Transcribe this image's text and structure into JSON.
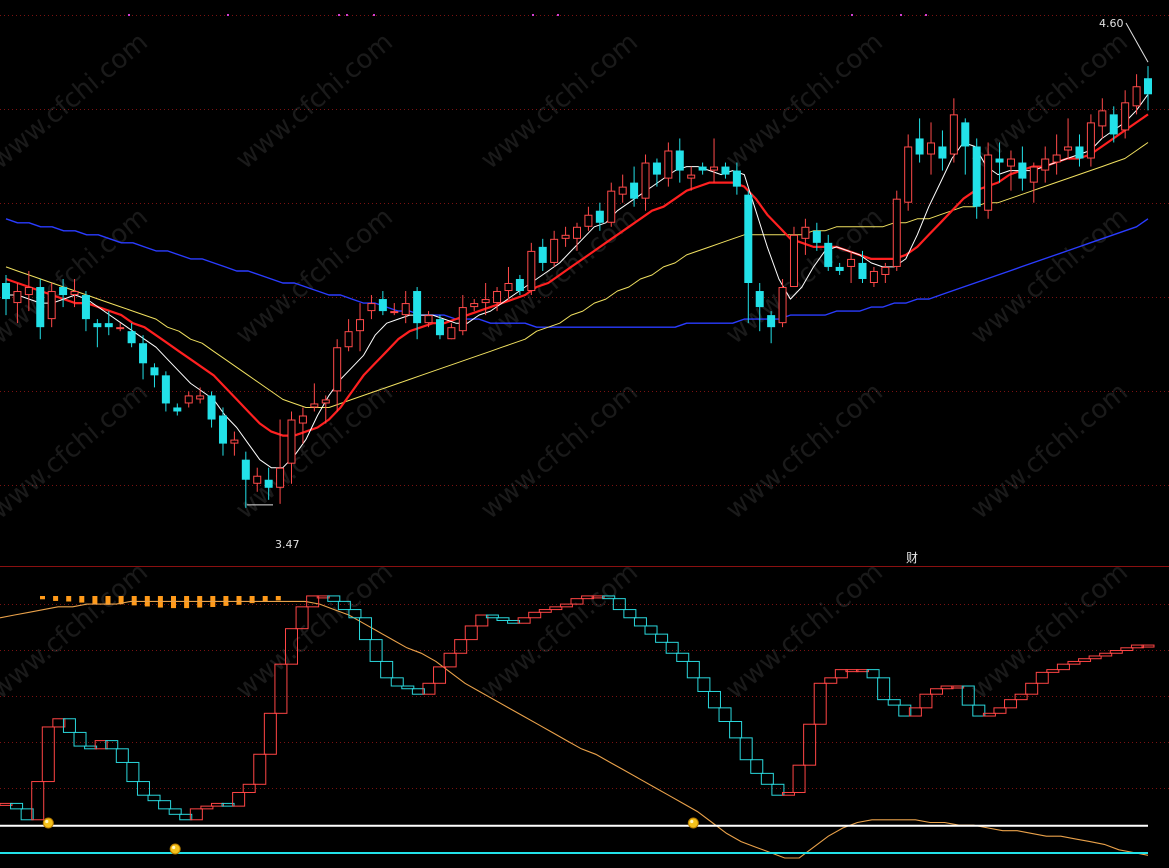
{
  "chart_data": [
    {
      "type": "candlestick",
      "panel": "price",
      "price_range": [
        3.4,
        4.72
      ],
      "grid": true,
      "annotations": {
        "high": "4.60",
        "low": "3.47",
        "finance_marker": "财"
      },
      "colors": {
        "up": "#ff4a4a",
        "down": "#22e1e8",
        "ma_fast": "#ffffff",
        "ma_mid": "#ff2020",
        "ma_slow": "#f0e060",
        "ma_long": "#2a3cff"
      },
      "candles": [
        {
          "o": 4.06,
          "h": 4.08,
          "l": 3.98,
          "c": 4.02
        },
        {
          "o": 4.01,
          "h": 4.06,
          "l": 3.96,
          "c": 4.04
        },
        {
          "o": 4.03,
          "h": 4.09,
          "l": 3.99,
          "c": 4.05
        },
        {
          "o": 4.05,
          "h": 4.07,
          "l": 3.92,
          "c": 3.95
        },
        {
          "o": 3.97,
          "h": 4.06,
          "l": 3.95,
          "c": 4.04
        },
        {
          "o": 4.05,
          "h": 4.07,
          "l": 4.0,
          "c": 4.03
        },
        {
          "o": 4.03,
          "h": 4.07,
          "l": 4.0,
          "c": 4.04
        },
        {
          "o": 4.03,
          "h": 4.04,
          "l": 3.94,
          "c": 3.97
        },
        {
          "o": 3.96,
          "h": 3.97,
          "l": 3.9,
          "c": 3.95
        },
        {
          "o": 3.96,
          "h": 3.99,
          "l": 3.93,
          "c": 3.95
        },
        {
          "o": 3.95,
          "h": 3.96,
          "l": 3.94,
          "c": 3.95
        },
        {
          "o": 3.94,
          "h": 3.96,
          "l": 3.9,
          "c": 3.91
        },
        {
          "o": 3.91,
          "h": 3.93,
          "l": 3.82,
          "c": 3.86
        },
        {
          "o": 3.85,
          "h": 3.86,
          "l": 3.8,
          "c": 3.83
        },
        {
          "o": 3.83,
          "h": 3.84,
          "l": 3.74,
          "c": 3.76
        },
        {
          "o": 3.75,
          "h": 3.76,
          "l": 3.73,
          "c": 3.74
        },
        {
          "o": 3.76,
          "h": 3.79,
          "l": 3.75,
          "c": 3.78
        },
        {
          "o": 3.77,
          "h": 3.8,
          "l": 3.76,
          "c": 3.78
        },
        {
          "o": 3.78,
          "h": 3.79,
          "l": 3.7,
          "c": 3.72
        },
        {
          "o": 3.73,
          "h": 3.75,
          "l": 3.63,
          "c": 3.66
        },
        {
          "o": 3.66,
          "h": 3.69,
          "l": 3.63,
          "c": 3.67
        },
        {
          "o": 3.62,
          "h": 3.64,
          "l": 3.5,
          "c": 3.57
        },
        {
          "o": 3.56,
          "h": 3.6,
          "l": 3.54,
          "c": 3.58
        },
        {
          "o": 3.57,
          "h": 3.6,
          "l": 3.52,
          "c": 3.55
        },
        {
          "o": 3.55,
          "h": 3.72,
          "l": 3.51,
          "c": 3.6
        },
        {
          "o": 3.61,
          "h": 3.74,
          "l": 3.56,
          "c": 3.72
        },
        {
          "o": 3.71,
          "h": 3.75,
          "l": 3.66,
          "c": 3.73
        },
        {
          "o": 3.75,
          "h": 3.81,
          "l": 3.74,
          "c": 3.76
        },
        {
          "o": 3.76,
          "h": 3.78,
          "l": 3.71,
          "c": 3.77
        },
        {
          "o": 3.79,
          "h": 3.92,
          "l": 3.74,
          "c": 3.9
        },
        {
          "o": 3.9,
          "h": 3.97,
          "l": 3.89,
          "c": 3.94
        },
        {
          "o": 3.94,
          "h": 4.01,
          "l": 3.89,
          "c": 3.97
        },
        {
          "o": 3.99,
          "h": 4.03,
          "l": 3.97,
          "c": 4.01
        },
        {
          "o": 4.02,
          "h": 4.04,
          "l": 3.98,
          "c": 3.99
        },
        {
          "o": 3.99,
          "h": 4.01,
          "l": 3.98,
          "c": 3.99
        },
        {
          "o": 3.98,
          "h": 4.04,
          "l": 3.96,
          "c": 4.01
        },
        {
          "o": 4.04,
          "h": 4.05,
          "l": 3.92,
          "c": 3.96
        },
        {
          "o": 3.96,
          "h": 3.99,
          "l": 3.95,
          "c": 3.98
        },
        {
          "o": 3.97,
          "h": 3.98,
          "l": 3.92,
          "c": 3.93
        },
        {
          "o": 3.92,
          "h": 3.96,
          "l": 3.92,
          "c": 3.95
        },
        {
          "o": 3.94,
          "h": 4.03,
          "l": 3.93,
          "c": 4.0
        },
        {
          "o": 4.0,
          "h": 4.02,
          "l": 3.99,
          "c": 4.01
        },
        {
          "o": 4.01,
          "h": 4.06,
          "l": 3.98,
          "c": 4.02
        },
        {
          "o": 4.01,
          "h": 4.05,
          "l": 3.99,
          "c": 4.04
        },
        {
          "o": 4.04,
          "h": 4.1,
          "l": 4.02,
          "c": 4.06
        },
        {
          "o": 4.07,
          "h": 4.08,
          "l": 4.03,
          "c": 4.04
        },
        {
          "o": 4.04,
          "h": 4.16,
          "l": 4.03,
          "c": 4.14
        },
        {
          "o": 4.15,
          "h": 4.17,
          "l": 4.09,
          "c": 4.11
        },
        {
          "o": 4.11,
          "h": 4.19,
          "l": 4.1,
          "c": 4.17
        },
        {
          "o": 4.17,
          "h": 4.2,
          "l": 4.15,
          "c": 4.18
        },
        {
          "o": 4.17,
          "h": 4.21,
          "l": 4.14,
          "c": 4.2
        },
        {
          "o": 4.2,
          "h": 4.25,
          "l": 4.19,
          "c": 4.23
        },
        {
          "o": 4.24,
          "h": 4.26,
          "l": 4.19,
          "c": 4.21
        },
        {
          "o": 4.21,
          "h": 4.31,
          "l": 4.2,
          "c": 4.29
        },
        {
          "o": 4.28,
          "h": 4.33,
          "l": 4.26,
          "c": 4.3
        },
        {
          "o": 4.31,
          "h": 4.35,
          "l": 4.25,
          "c": 4.27
        },
        {
          "o": 4.27,
          "h": 4.38,
          "l": 4.24,
          "c": 4.36
        },
        {
          "o": 4.36,
          "h": 4.37,
          "l": 4.3,
          "c": 4.33
        },
        {
          "o": 4.32,
          "h": 4.41,
          "l": 4.3,
          "c": 4.39
        },
        {
          "o": 4.39,
          "h": 4.42,
          "l": 4.31,
          "c": 4.34
        },
        {
          "o": 4.32,
          "h": 4.35,
          "l": 4.29,
          "c": 4.33
        },
        {
          "o": 4.35,
          "h": 4.36,
          "l": 4.33,
          "c": 4.34
        },
        {
          "o": 4.34,
          "h": 4.42,
          "l": 4.31,
          "c": 4.35
        },
        {
          "o": 4.35,
          "h": 4.36,
          "l": 4.32,
          "c": 4.33
        },
        {
          "o": 4.34,
          "h": 4.36,
          "l": 4.28,
          "c": 4.3
        },
        {
          "o": 4.28,
          "h": 4.29,
          "l": 3.96,
          "c": 4.06
        },
        {
          "o": 4.04,
          "h": 4.06,
          "l": 3.94,
          "c": 4.0
        },
        {
          "o": 3.98,
          "h": 3.99,
          "l": 3.91,
          "c": 3.95
        },
        {
          "o": 3.96,
          "h": 4.07,
          "l": 3.95,
          "c": 4.05
        },
        {
          "o": 4.05,
          "h": 4.2,
          "l": 4.05,
          "c": 4.18
        },
        {
          "o": 4.17,
          "h": 4.22,
          "l": 4.13,
          "c": 4.2
        },
        {
          "o": 4.19,
          "h": 4.21,
          "l": 4.14,
          "c": 4.16
        },
        {
          "o": 4.16,
          "h": 4.18,
          "l": 4.09,
          "c": 4.1
        },
        {
          "o": 4.1,
          "h": 4.11,
          "l": 4.08,
          "c": 4.09
        },
        {
          "o": 4.1,
          "h": 4.14,
          "l": 4.06,
          "c": 4.12
        },
        {
          "o": 4.11,
          "h": 4.14,
          "l": 4.06,
          "c": 4.07
        },
        {
          "o": 4.06,
          "h": 4.1,
          "l": 4.05,
          "c": 4.09
        },
        {
          "o": 4.08,
          "h": 4.11,
          "l": 4.06,
          "c": 4.1
        },
        {
          "o": 4.1,
          "h": 4.29,
          "l": 4.09,
          "c": 4.27
        },
        {
          "o": 4.26,
          "h": 4.43,
          "l": 4.24,
          "c": 4.4
        },
        {
          "o": 4.42,
          "h": 4.47,
          "l": 4.36,
          "c": 4.38
        },
        {
          "o": 4.38,
          "h": 4.46,
          "l": 4.33,
          "c": 4.41
        },
        {
          "o": 4.4,
          "h": 4.44,
          "l": 4.34,
          "c": 4.37
        },
        {
          "o": 4.38,
          "h": 4.52,
          "l": 4.36,
          "c": 4.48
        },
        {
          "o": 4.46,
          "h": 4.47,
          "l": 4.33,
          "c": 4.4
        },
        {
          "o": 4.4,
          "h": 4.42,
          "l": 4.22,
          "c": 4.25
        },
        {
          "o": 4.24,
          "h": 4.41,
          "l": 4.22,
          "c": 4.38
        },
        {
          "o": 4.37,
          "h": 4.41,
          "l": 4.31,
          "c": 4.36
        },
        {
          "o": 4.35,
          "h": 4.39,
          "l": 4.29,
          "c": 4.37
        },
        {
          "o": 4.36,
          "h": 4.4,
          "l": 4.29,
          "c": 4.32
        },
        {
          "o": 4.31,
          "h": 4.36,
          "l": 4.26,
          "c": 4.35
        },
        {
          "o": 4.34,
          "h": 4.4,
          "l": 4.31,
          "c": 4.37
        },
        {
          "o": 4.36,
          "h": 4.43,
          "l": 4.33,
          "c": 4.38
        },
        {
          "o": 4.39,
          "h": 4.47,
          "l": 4.37,
          "c": 4.4
        },
        {
          "o": 4.4,
          "h": 4.43,
          "l": 4.35,
          "c": 4.37
        },
        {
          "o": 4.37,
          "h": 4.48,
          "l": 4.35,
          "c": 4.46
        },
        {
          "o": 4.45,
          "h": 4.52,
          "l": 4.42,
          "c": 4.49
        },
        {
          "o": 4.48,
          "h": 4.5,
          "l": 4.41,
          "c": 4.43
        },
        {
          "o": 4.44,
          "h": 4.54,
          "l": 4.42,
          "c": 4.51
        },
        {
          "o": 4.5,
          "h": 4.58,
          "l": 4.48,
          "c": 4.55
        },
        {
          "o": 4.57,
          "h": 4.6,
          "l": 4.49,
          "c": 4.53
        }
      ],
      "ma_fast": [
        4.03,
        4.03,
        4.02,
        4.01,
        4.01,
        4.02,
        4.03,
        4.02,
        4.0,
        3.98,
        3.96,
        3.94,
        3.92,
        3.9,
        3.87,
        3.84,
        3.81,
        3.79,
        3.77,
        3.73,
        3.7,
        3.66,
        3.62,
        3.6,
        3.6,
        3.63,
        3.67,
        3.73,
        3.78,
        3.82,
        3.85,
        3.88,
        3.93,
        3.96,
        3.97,
        3.98,
        3.98,
        3.98,
        3.97,
        3.96,
        3.96,
        3.98,
        3.99,
        4.01,
        4.03,
        4.05,
        4.07,
        4.09,
        4.11,
        4.14,
        4.17,
        4.2,
        4.21,
        4.24,
        4.26,
        4.28,
        4.3,
        4.32,
        4.34,
        4.35,
        4.35,
        4.34,
        4.33,
        4.34,
        4.33,
        4.24,
        4.15,
        4.07,
        4.02,
        4.05,
        4.1,
        4.14,
        4.15,
        4.14,
        4.13,
        4.11,
        4.1,
        4.1,
        4.12,
        4.18,
        4.25,
        4.31,
        4.37,
        4.41,
        4.4,
        4.35,
        4.33,
        4.34,
        4.34,
        4.34,
        4.35,
        4.36,
        4.37,
        4.38,
        4.39,
        4.42,
        4.44,
        4.46,
        4.49,
        4.53
      ],
      "ma_mid": [
        4.07,
        4.06,
        4.05,
        4.04,
        4.03,
        4.02,
        4.01,
        4.01,
        4.0,
        3.99,
        3.98,
        3.96,
        3.95,
        3.93,
        3.91,
        3.89,
        3.87,
        3.85,
        3.83,
        3.8,
        3.77,
        3.74,
        3.71,
        3.69,
        3.68,
        3.68,
        3.69,
        3.7,
        3.72,
        3.75,
        3.79,
        3.83,
        3.86,
        3.89,
        3.92,
        3.94,
        3.95,
        3.96,
        3.96,
        3.97,
        3.98,
        3.99,
        4.0,
        4.01,
        4.02,
        4.03,
        4.05,
        4.06,
        4.08,
        4.1,
        4.12,
        4.14,
        4.16,
        4.18,
        4.2,
        4.22,
        4.24,
        4.25,
        4.27,
        4.29,
        4.3,
        4.31,
        4.31,
        4.31,
        4.3,
        4.27,
        4.23,
        4.2,
        4.17,
        4.16,
        4.15,
        4.15,
        4.15,
        4.14,
        4.13,
        4.12,
        4.12,
        4.12,
        4.13,
        4.15,
        4.18,
        4.21,
        4.24,
        4.27,
        4.29,
        4.3,
        4.31,
        4.33,
        4.34,
        4.35,
        4.35,
        4.36,
        4.37,
        4.37,
        4.38,
        4.4,
        4.42,
        4.44,
        4.46,
        4.48
      ],
      "ma_slow": [
        4.1,
        4.09,
        4.08,
        4.07,
        4.06,
        4.05,
        4.04,
        4.03,
        4.02,
        4.01,
        4.0,
        3.99,
        3.98,
        3.97,
        3.95,
        3.94,
        3.92,
        3.91,
        3.89,
        3.87,
        3.85,
        3.83,
        3.81,
        3.79,
        3.77,
        3.76,
        3.75,
        3.75,
        3.75,
        3.76,
        3.77,
        3.78,
        3.79,
        3.8,
        3.81,
        3.82,
        3.83,
        3.84,
        3.85,
        3.86,
        3.87,
        3.88,
        3.89,
        3.9,
        3.91,
        3.92,
        3.94,
        3.95,
        3.96,
        3.98,
        3.99,
        4.01,
        4.02,
        4.04,
        4.05,
        4.07,
        4.08,
        4.1,
        4.11,
        4.13,
        4.14,
        4.15,
        4.16,
        4.17,
        4.18,
        4.18,
        4.18,
        4.18,
        4.18,
        4.18,
        4.19,
        4.19,
        4.2,
        4.2,
        4.2,
        4.2,
        4.2,
        4.21,
        4.21,
        4.22,
        4.22,
        4.23,
        4.24,
        4.25,
        4.25,
        4.26,
        4.26,
        4.27,
        4.28,
        4.29,
        4.3,
        4.31,
        4.32,
        4.33,
        4.34,
        4.35,
        4.36,
        4.37,
        4.39,
        4.41
      ],
      "ma_long": [
        4.22,
        4.21,
        4.21,
        4.2,
        4.2,
        4.19,
        4.19,
        4.18,
        4.18,
        4.17,
        4.16,
        4.16,
        4.15,
        4.14,
        4.14,
        4.13,
        4.12,
        4.12,
        4.11,
        4.1,
        4.09,
        4.09,
        4.08,
        4.07,
        4.06,
        4.06,
        4.05,
        4.04,
        4.03,
        4.03,
        4.02,
        4.01,
        4.01,
        4.0,
        3.99,
        3.99,
        3.98,
        3.98,
        3.98,
        3.97,
        3.97,
        3.97,
        3.96,
        3.96,
        3.96,
        3.96,
        3.95,
        3.95,
        3.95,
        3.95,
        3.95,
        3.95,
        3.95,
        3.95,
        3.95,
        3.95,
        3.95,
        3.95,
        3.95,
        3.96,
        3.96,
        3.96,
        3.96,
        3.96,
        3.97,
        3.97,
        3.97,
        3.97,
        3.98,
        3.98,
        3.98,
        3.98,
        3.99,
        3.99,
        3.99,
        4.0,
        4.0,
        4.01,
        4.01,
        4.02,
        4.02,
        4.03,
        4.04,
        4.05,
        4.06,
        4.07,
        4.08,
        4.09,
        4.1,
        4.11,
        4.12,
        4.13,
        4.14,
        4.15,
        4.16,
        4.17,
        4.18,
        4.19,
        4.2,
        4.22
      ]
    },
    {
      "type": "indicator",
      "panel": "oscillator",
      "value_range": [
        0,
        100
      ],
      "reference_lines": [
        12,
        2
      ],
      "colors": {
        "up_box": "#ff4545",
        "down_box": "#2ad7dc",
        "line": "#e9a14a",
        "bars": "#ff9a1a",
        "ref_white": "#ffffff",
        "ref_cyan": "#22e1e8"
      },
      "box_values": [
        20,
        18,
        14,
        28,
        48,
        51,
        46,
        41,
        40,
        43,
        40,
        35,
        28,
        23,
        21,
        18,
        16,
        14,
        18,
        19,
        20,
        19,
        24,
        27,
        38,
        53,
        71,
        84,
        92,
        96,
        96,
        94,
        91,
        88,
        80,
        72,
        66,
        63,
        62,
        60,
        64,
        70,
        75,
        80,
        85,
        89,
        88,
        87,
        86,
        88,
        90,
        91,
        92,
        93,
        95,
        96,
        96,
        95,
        91,
        88,
        85,
        82,
        79,
        75,
        72,
        66,
        61,
        55,
        50,
        44,
        36,
        31,
        27,
        23,
        24,
        34,
        49,
        64,
        66,
        69,
        69,
        69,
        66,
        58,
        56,
        52,
        55,
        60,
        62,
        63,
        63,
        56,
        52,
        53,
        55,
        58,
        60,
        64,
        68,
        69,
        71,
        72,
        73,
        74,
        75,
        76,
        77,
        78,
        78
      ],
      "line_values": [
        88,
        89,
        90,
        91,
        92,
        92,
        93,
        93,
        93,
        94,
        94,
        94,
        94,
        94,
        94,
        94,
        94,
        94,
        94,
        94,
        94,
        94,
        93,
        91,
        89,
        86,
        83,
        80,
        77,
        75,
        72,
        68,
        64,
        61,
        58,
        55,
        52,
        49,
        46,
        43,
        40,
        38,
        35,
        32,
        29,
        26,
        23,
        20,
        17,
        13,
        9,
        6,
        4,
        2,
        0,
        0,
        4,
        8,
        11,
        13,
        14,
        14,
        14,
        14,
        13,
        13,
        12,
        12,
        11,
        10,
        10,
        9,
        8,
        8,
        7,
        6,
        5,
        3,
        2,
        1
      ],
      "bar_values": [
        6,
        9,
        10,
        12,
        14,
        16,
        15,
        17,
        19,
        21,
        22,
        22,
        21,
        20,
        18,
        16,
        13,
        10,
        8
      ],
      "buy_signals": [
        12,
        4,
        13
      ]
    }
  ]
}
